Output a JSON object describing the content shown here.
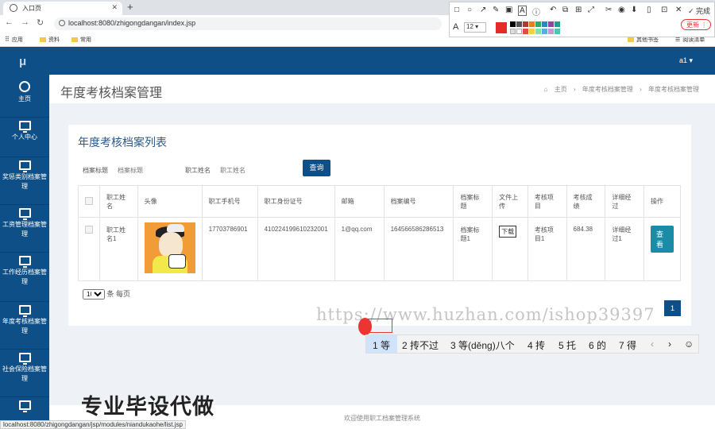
{
  "browser": {
    "tab_title": "入口页",
    "url": "localhost:8080/zhigongdangan/index.jsp",
    "bookmarks": [
      "应用",
      "资料",
      "常用"
    ],
    "bookmarks_right": [
      "其他书签",
      "阅读清单"
    ],
    "status_url": "localhost:8080/zhigongdangan/jsp/modules/niandukaohe/list.jsp"
  },
  "annotation": {
    "font_size": "12",
    "done_label": "完成",
    "update_label": "更新",
    "active_color": "#e32b2b"
  },
  "app": {
    "logo": "μ",
    "user": "a1 ▾"
  },
  "sidebar": {
    "items": [
      {
        "label": "主页",
        "icon": "dashboard-icon"
      },
      {
        "label": "个人中心",
        "icon": "monitor-icon"
      },
      {
        "label": "奖惩类别档案管理",
        "icon": "monitor-icon"
      },
      {
        "label": "工资管理档案管理",
        "icon": "monitor-icon"
      },
      {
        "label": "工作经历档案管理",
        "icon": "monitor-icon"
      },
      {
        "label": "年度考核档案管理",
        "icon": "monitor-icon"
      },
      {
        "label": "社会保险档案管理",
        "icon": "monitor-icon"
      },
      {
        "label": "",
        "icon": "monitor-icon"
      }
    ]
  },
  "header": {
    "page_title": "年度考核档案管理",
    "breadcrumb": [
      "主页",
      "年度考核档案管理",
      "年度考核档案管理"
    ]
  },
  "list": {
    "title": "年度考核档案列表",
    "filter_title_label": "档案标题",
    "filter_title_placeholder": "档案标题",
    "filter_name_label": "职工姓名",
    "filter_name_placeholder": "职工姓名",
    "query_button": "查询",
    "columns": [
      "职工姓名",
      "头像",
      "职工手机号",
      "职工身份证号",
      "邮箱",
      "档案编号",
      "档案标题",
      "文件上传",
      "考核项目",
      "考核成绩",
      "详细经过",
      "操作"
    ],
    "rows": [
      {
        "name": "职工姓名1",
        "phone": "17703786901",
        "id_card": "410224199610232001",
        "email": "1@qq.com",
        "record_no": "164566586286513",
        "record_title": "档案标题1",
        "file_action": "下载",
        "item": "考核项目1",
        "score": "684.38",
        "detail": "详细经过1",
        "action": "查看"
      }
    ],
    "page_size": "10",
    "page_size_suffix": "条 每页",
    "current_page": "1"
  },
  "watermark": "https://www.huzhan.com/ishop39397",
  "ime": {
    "candidates": [
      "1 等",
      "2 抟不过",
      "3 等(děng)八个",
      "4 抟",
      "5 托",
      "6 的",
      "7 得"
    ]
  },
  "promo_text": "专业毕设代做",
  "footer": "欢迎使用职工档案管理系统"
}
